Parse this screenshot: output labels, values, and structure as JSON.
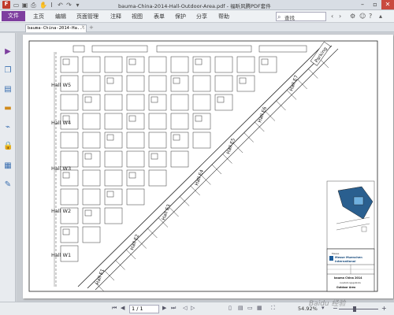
{
  "window": {
    "title": "bauma-China-2014-Hall-Outdoor-Area.pdf - 福昕风腾PDF套件",
    "app_logo": "F",
    "controls": {
      "minimize": "–",
      "restore": "▫",
      "close": "✕"
    }
  },
  "menubar": {
    "file_label": "文件",
    "items": [
      "主页",
      "编辑",
      "页面管理",
      "注释",
      "视图",
      "表单",
      "保护",
      "分享",
      "帮助"
    ],
    "search_placeholder": "查找",
    "accent_color": "#7e3f9f"
  },
  "tab": {
    "label": "bauma-China-2014-Ha...",
    "close": "×",
    "add": "+"
  },
  "left_panel": {
    "icons": [
      "bookmark-icon",
      "pages-icon",
      "layers-icon",
      "comments-icon",
      "attachments-icon",
      "security-icon",
      "signature-icon",
      "tools-icon"
    ]
  },
  "drawing": {
    "hall_labels_left": [
      "Hall W5",
      "Hall W4",
      "Hall W3",
      "Hall W2",
      "Hall W1"
    ],
    "hall_labels_diag": [
      "Hall E1",
      "Hall E2",
      "Hall E3",
      "Hall E4",
      "Hall E5",
      "Hall E6",
      "Hall E7"
    ],
    "parking": "Parking",
    "title_block": {
      "company_small": "Messe",
      "company_line1": "Messe Muenchen",
      "company_line2": "International",
      "event": "bauma China 2014",
      "hall": "Outdoor Area",
      "small_line": "Ausstellungsgelände"
    }
  },
  "statusbar": {
    "page_value": "1 / 1",
    "zoom": "54.92%",
    "nav": {
      "first": "⏮",
      "prev": "◀",
      "next": "▶",
      "last": "⏭"
    },
    "zoom_minus": "−",
    "zoom_plus": "+",
    "zoom_level": 0.4
  },
  "watermark": "Baidu 经验"
}
